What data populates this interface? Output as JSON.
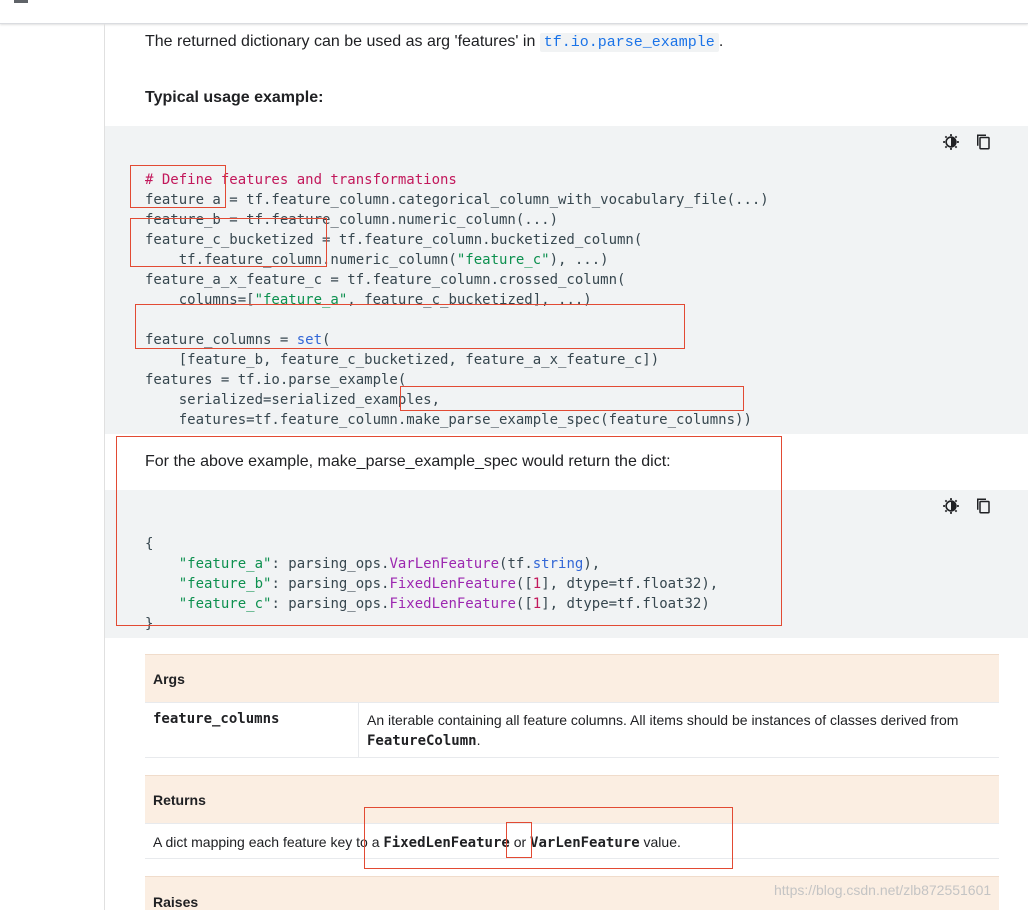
{
  "intro": {
    "text_prefix": "The returned dictionary can be used as arg 'features' in ",
    "code": "tf.io.parse_example",
    "text_suffix": "."
  },
  "usage_heading": "Typical usage example:",
  "code1": {
    "comment": "# Define features and transformations",
    "l2": "feature_a = tf.feature_column.categorical_column_with_vocabulary_file(...)",
    "l3": "feature_b = tf.feature_column.numeric_column(...)",
    "l4": "feature_c_bucketized = tf.feature_column.bucketized_column(",
    "l5a": "    tf.feature_column.numeric_column(",
    "l5s": "\"feature_c\"",
    "l5b": "), ...)",
    "l6": "feature_a_x_feature_c = tf.feature_column.crossed_column(",
    "l7a": "    columns=[",
    "l7s": "\"feature_a\"",
    "l7b": ", feature_c_bucketized], ...)",
    "l9a": "feature_columns = ",
    "l9k": "set",
    "l9b": "(",
    "l10": "    [feature_b, feature_c_bucketized, feature_a_x_feature_c])",
    "l11": "features = tf.io.parse_example(",
    "l12": "    serialized=serialized_examples,",
    "l13": "    features=tf.feature_column.make_parse_example_spec(feature_columns))"
  },
  "above_text": "For the above example, make_parse_example_spec would return the dict:",
  "code2": {
    "open": "{",
    "a_key": "\"feature_a\"",
    "a_mid": ": parsing_ops.",
    "a_type": "VarLenFeature",
    "a_pre": "(tf.",
    "a_kw": "string",
    "a_end": "),",
    "b_key": "\"feature_b\"",
    "b_mid": ": parsing_ops.",
    "b_type": "FixedLenFeature",
    "b_pre": "([",
    "b_num": "1",
    "b_end": "], dtype=tf.float32),",
    "c_key": "\"feature_c\"",
    "c_mid": ": parsing_ops.",
    "c_type": "FixedLenFeature",
    "c_pre": "([",
    "c_num": "1",
    "c_end": "], dtype=tf.float32)",
    "close": "}"
  },
  "icons": [
    "theme-toggle-icon",
    "copy-icon"
  ],
  "args": {
    "heading": "Args",
    "name": "feature_columns",
    "desc": "An iterable containing all feature columns. All items should be instances of classes derived from ",
    "desc_code": "FeatureColumn",
    "desc_end": "."
  },
  "returns": {
    "heading": "Returns",
    "text1": "A dict mapping each feature key to a ",
    "code1": "FixedLenFeature",
    "mid": " or ",
    "code2": "VarLenFeature",
    "end": " value."
  },
  "raises": {
    "heading": "Raises"
  },
  "watermark": "https://blog.csdn.net/zlb872551601",
  "colors": {
    "highlight_box": "#e24a33",
    "code_bg": "#f1f3f4",
    "table_head_bg": "#fbeee2"
  }
}
